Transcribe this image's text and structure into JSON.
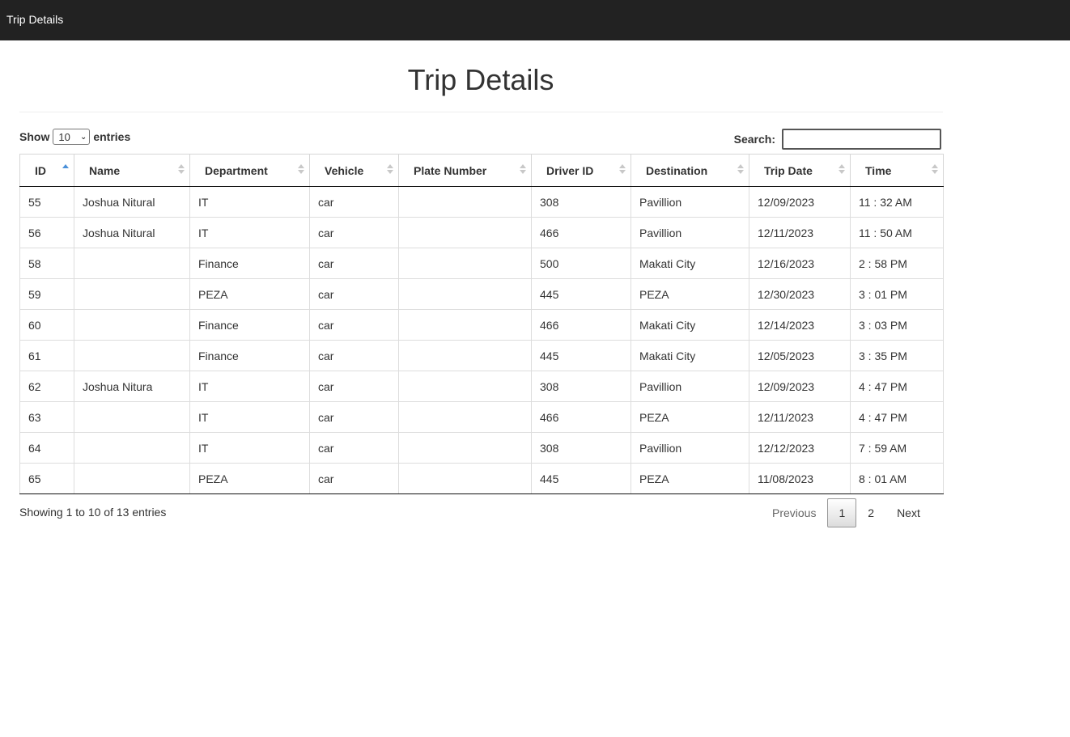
{
  "topbar": {
    "brand": "Trip Details"
  },
  "page": {
    "title": "Trip Details"
  },
  "controls": {
    "show_label": "Show",
    "entries_label": "entries",
    "page_length": "10",
    "search_label": "Search:",
    "search_value": ""
  },
  "table": {
    "columns": [
      "ID",
      "Name",
      "Department",
      "Vehicle",
      "Plate Number",
      "Driver ID",
      "Destination",
      "Trip Date",
      "Time"
    ],
    "rows": [
      [
        "55",
        "Joshua Nitural",
        "IT",
        "car",
        "",
        "308",
        "Pavillion",
        "12/09/2023",
        "11 : 32 AM"
      ],
      [
        "56",
        "Joshua Nitural",
        "IT",
        "car",
        "",
        "466",
        "Pavillion",
        "12/11/2023",
        "11 : 50 AM"
      ],
      [
        "58",
        "",
        "Finance",
        "car",
        "",
        "500",
        "Makati City",
        "12/16/2023",
        "2 : 58 PM"
      ],
      [
        "59",
        "",
        "PEZA",
        "car",
        "",
        "445",
        "PEZA",
        "12/30/2023",
        "3 : 01 PM"
      ],
      [
        "60",
        "",
        "Finance",
        "car",
        "",
        "466",
        "Makati City",
        "12/14/2023",
        "3 : 03 PM"
      ],
      [
        "61",
        "",
        "Finance",
        "car",
        "",
        "445",
        "Makati City",
        "12/05/2023",
        "3 : 35 PM"
      ],
      [
        "62",
        "Joshua Nitura",
        "IT",
        "car",
        "",
        "308",
        "Pavillion",
        "12/09/2023",
        "4 : 47 PM"
      ],
      [
        "63",
        "",
        "IT",
        "car",
        "",
        "466",
        "PEZA",
        "12/11/2023",
        "4 : 47 PM"
      ],
      [
        "64",
        "",
        "IT",
        "car",
        "",
        "308",
        "Pavillion",
        "12/12/2023",
        "7 : 59 AM"
      ],
      [
        "65",
        "",
        "PEZA",
        "car",
        "",
        "445",
        "PEZA",
        "11/08/2023",
        "8 : 01 AM"
      ]
    ]
  },
  "footer": {
    "info": "Showing 1 to 10 of 13 entries",
    "pagination": {
      "previous": "Previous",
      "pages": [
        "1",
        "2"
      ],
      "current": "1",
      "next": "Next"
    }
  },
  "colors": {
    "topbar": "#222222",
    "sort_active": "#4a90d9"
  }
}
